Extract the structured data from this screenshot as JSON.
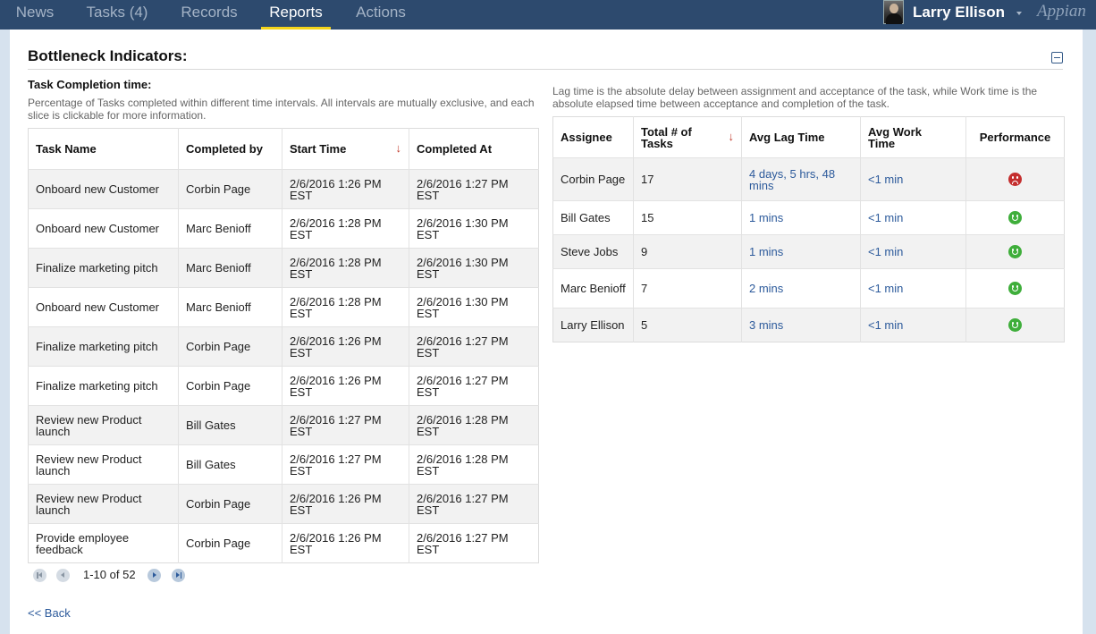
{
  "nav": {
    "tabs": [
      {
        "label": "News"
      },
      {
        "label": "Tasks (4)"
      },
      {
        "label": "Records"
      },
      {
        "label": "Reports"
      },
      {
        "label": "Actions"
      }
    ],
    "active_tab": "Reports",
    "user_name": "Larry Ellison",
    "brand": "Appian",
    "accent_color": "#f4d41b",
    "bar_color": "#2d4a6e"
  },
  "page": {
    "title": "Bottleneck Indicators:",
    "back_label": "<< Back"
  },
  "task_completion": {
    "heading": "Task Completion time:",
    "description": "Percentage of Tasks completed within different time intervals. All intervals are mutually exclusive, and each slice is clickable for more information.",
    "columns": [
      "Task Name",
      "Completed by",
      "Start Time",
      "Completed At"
    ],
    "sorted_column": "Start Time",
    "sort_icon": "arrow-down-icon",
    "rows": [
      {
        "task": "Onboard new Customer",
        "by": "Corbin Page",
        "start": "2/6/2016 1:26 PM EST",
        "completed": "2/6/2016 1:27 PM EST"
      },
      {
        "task": "Onboard new Customer",
        "by": "Marc Benioff",
        "start": "2/6/2016 1:28 PM EST",
        "completed": "2/6/2016 1:30 PM EST"
      },
      {
        "task": "Finalize marketing pitch",
        "by": "Marc Benioff",
        "start": "2/6/2016 1:28 PM EST",
        "completed": "2/6/2016 1:30 PM EST"
      },
      {
        "task": "Onboard new Customer",
        "by": "Marc Benioff",
        "start": "2/6/2016 1:28 PM EST",
        "completed": "2/6/2016 1:30 PM EST"
      },
      {
        "task": "Finalize marketing pitch",
        "by": "Corbin Page",
        "start": "2/6/2016 1:26 PM EST",
        "completed": "2/6/2016 1:27 PM EST"
      },
      {
        "task": "Finalize marketing pitch",
        "by": "Corbin Page",
        "start": "2/6/2016 1:26 PM EST",
        "completed": "2/6/2016 1:27 PM EST"
      },
      {
        "task": "Review new Product launch",
        "by": "Bill Gates",
        "start": "2/6/2016 1:27 PM EST",
        "completed": "2/6/2016 1:28 PM EST"
      },
      {
        "task": "Review new Product launch",
        "by": "Bill Gates",
        "start": "2/6/2016 1:27 PM EST",
        "completed": "2/6/2016 1:28 PM EST"
      },
      {
        "task": "Review new Product launch",
        "by": "Corbin Page",
        "start": "2/6/2016 1:26 PM EST",
        "completed": "2/6/2016 1:27 PM EST"
      },
      {
        "task": "Provide employee feedback",
        "by": "Corbin Page",
        "start": "2/6/2016 1:26 PM EST",
        "completed": "2/6/2016 1:27 PM EST"
      }
    ],
    "pager": {
      "range_label": "1-10 of 52",
      "icons": [
        "first-page-icon",
        "previous-page-icon",
        "next-page-icon",
        "last-page-icon"
      ]
    }
  },
  "lag_time": {
    "description": "Lag time is the absolute delay between assignment and acceptance of the task, while Work time is the absolute elapsed time between acceptance and completion of the task.",
    "columns": [
      "Assignee",
      "Total # of Tasks",
      "Avg Lag Time",
      "Avg Work Time",
      "Performance"
    ],
    "sorted_column": "Total # of Tasks",
    "sort_icon": "arrow-down-icon",
    "rows": [
      {
        "assignee": "Corbin Page",
        "total": "17",
        "lag": "4 days, 5 hrs, 48 mins",
        "work": "<1 min",
        "performance": "sad-face-icon",
        "performance_color": "#c42e2e"
      },
      {
        "assignee": "Bill Gates",
        "total": "15",
        "lag": "1 mins",
        "work": "<1 min",
        "performance": "happy-face-icon",
        "performance_color": "#3fae3b"
      },
      {
        "assignee": "Steve Jobs",
        "total": "9",
        "lag": "1 mins",
        "work": "<1 min",
        "performance": "happy-face-icon",
        "performance_color": "#3fae3b"
      },
      {
        "assignee": "Marc Benioff",
        "total": "7",
        "lag": "2 mins",
        "work": "<1 min",
        "performance": "happy-face-icon",
        "performance_color": "#3fae3b"
      },
      {
        "assignee": "Larry Ellison",
        "total": "5",
        "lag": "3 mins",
        "work": "<1 min",
        "performance": "happy-face-icon",
        "performance_color": "#3fae3b"
      }
    ]
  }
}
